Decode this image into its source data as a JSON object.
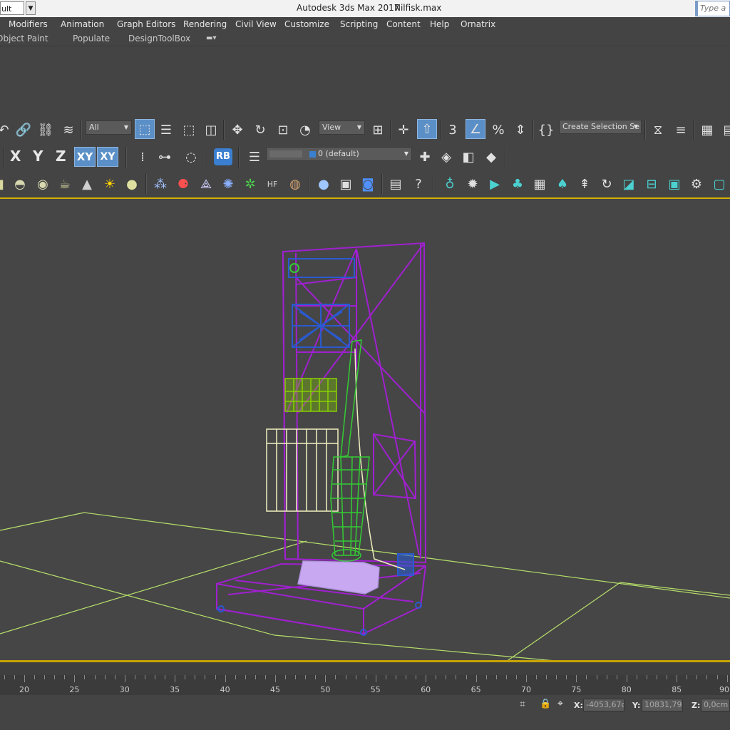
{
  "titlebar": {
    "workspace_value": "ult",
    "app_title": "Autodesk 3ds Max 2017",
    "file_name": "Nilfisk.max",
    "search_placeholder": "Type a"
  },
  "menubar": {
    "items": [
      "Modifiers",
      "Animation",
      "Graph Editors",
      "Rendering",
      "Civil View",
      "Customize",
      "Scripting",
      "Content",
      "Help",
      "Ornatrix"
    ]
  },
  "sub_menubar": {
    "items": [
      "Object Paint",
      "Populate",
      "DesignToolBox"
    ]
  },
  "toolbar1": {
    "filter_value": "All",
    "coord_system_value": "View",
    "selection_set_value": "Create Selection Se"
  },
  "toolbar2": {
    "axis_x": "X",
    "axis_y": "Y",
    "axis_z": "Z",
    "axis_xy": "XY",
    "axis_xy_alt": "XY",
    "rb_label": "RB",
    "layer_value": "0 (default)"
  },
  "timeline": {
    "tick_labels": [
      "20",
      "25",
      "30",
      "35",
      "40",
      "45",
      "50",
      "55",
      "60",
      "65",
      "70",
      "75",
      "80",
      "85",
      "90"
    ]
  },
  "status": {
    "x_label": "X:",
    "x_value": "-4053,67cm",
    "y_label": "Y:",
    "y_value": "10831,792",
    "z_label": "Z:",
    "z_value": "0,0cm"
  },
  "colors": {
    "viewport_bg": "#464646",
    "viewport_border": "#d4b100",
    "active_button": "#5b8fc7",
    "grid_line": "#b7e06a",
    "wire_purple": "#a020d0",
    "wire_blue": "#2a5ad0",
    "wire_green": "#33cc33",
    "wire_lime": "#88d000",
    "wire_cream": "#f0f0c0",
    "wire_lavender": "#c8a8f0"
  }
}
